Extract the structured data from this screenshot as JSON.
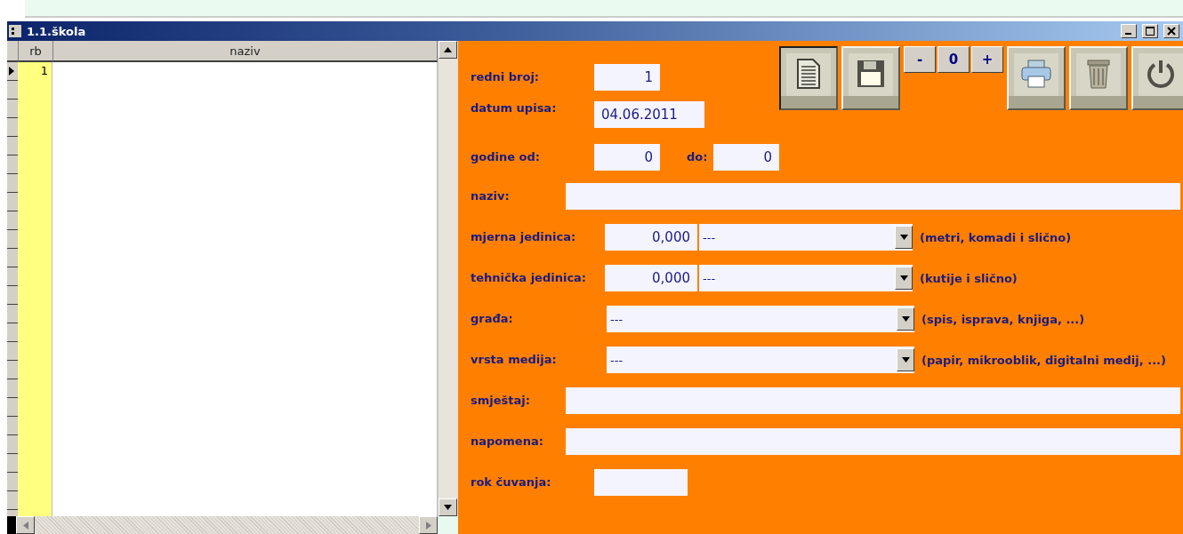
{
  "window": {
    "title": "1.1.škola"
  },
  "grid": {
    "columns": [
      "rb",
      "naziv"
    ],
    "rows": [
      {
        "cells": [
          "1",
          ""
        ],
        "selected": true
      }
    ]
  },
  "toolbar": {
    "counter": {
      "minus": "-",
      "value": "0",
      "plus": "+"
    }
  },
  "form": [
    {
      "kind": "number",
      "label": "redni broj:",
      "value": "1"
    },
    {
      "kind": "date",
      "label": "datum upisa:",
      "value": "04.06.2011"
    },
    {
      "kind": "range",
      "label": "godine od:",
      "value": "0",
      "label_to": "do:",
      "value_to": "0"
    },
    {
      "kind": "text",
      "label": "naziv:"
    },
    {
      "kind": "measure",
      "label": "mjerna jedinica:",
      "value": "0,000",
      "choice": "---",
      "hint": "(metri, komadi i slično)"
    },
    {
      "kind": "measure",
      "label": "tehnička jedinica:",
      "value": "0,000",
      "choice": "---",
      "hint": "(kutije i slično)"
    },
    {
      "kind": "combo",
      "label": "građa:",
      "choice": "---",
      "hint": "(spis, isprava, knjiga, ...)"
    },
    {
      "kind": "combo",
      "label": "vrsta medija:",
      "choice": "---",
      "hint": "(papir, mikrooblik, digitalni medij, ...)"
    },
    {
      "kind": "text",
      "label": "smještaj:"
    },
    {
      "kind": "text",
      "label": "napomena:"
    },
    {
      "kind": "short",
      "label": "rok čuvanja:"
    }
  ]
}
